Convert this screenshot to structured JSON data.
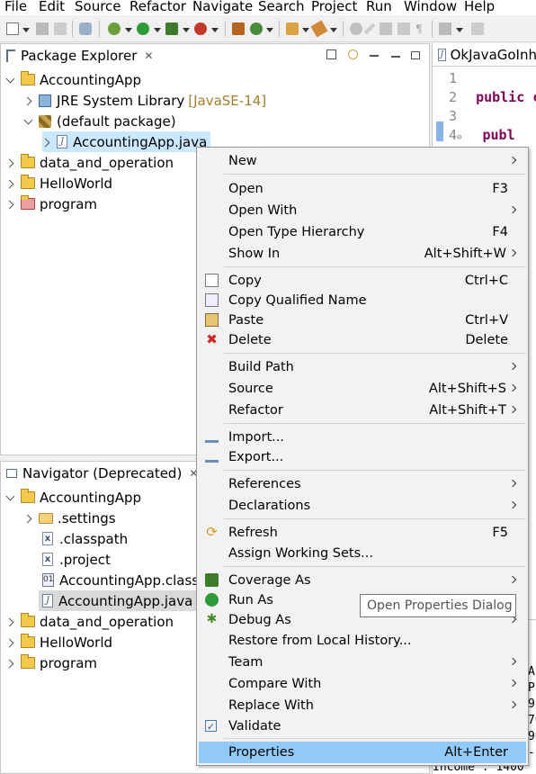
{
  "menubar": [
    "File",
    "Edit",
    "Source",
    "Refactor",
    "Navigate",
    "Search",
    "Project",
    "Run",
    "Window",
    "Help"
  ],
  "package_explorer": {
    "title": "Package Explorer",
    "close": "✕",
    "rows": [
      {
        "label": "AccountingApp"
      },
      {
        "label": "JRE System Library",
        "note": "[JavaSE-14]"
      },
      {
        "label": "(default package)"
      },
      {
        "label": "AccountingApp.java"
      },
      {
        "label": "data_and_operation"
      },
      {
        "label": "HelloWorld"
      },
      {
        "label": "program"
      }
    ]
  },
  "navigator": {
    "title": "Navigator (Deprecated)",
    "close": "✕",
    "rows": [
      {
        "label": "AccountingApp"
      },
      {
        "label": ".settings"
      },
      {
        "label": ".classpath"
      },
      {
        "label": ".project"
      },
      {
        "label": "AccountingApp.class"
      },
      {
        "label": "AccountingApp.java"
      },
      {
        "label": "data_and_operation"
      },
      {
        "label": "HelloWorld"
      },
      {
        "label": "program"
      }
    ]
  },
  "editor": {
    "tab": "OkJavaGoInh",
    "lines": [
      {
        "n": "1",
        "text": ""
      },
      {
        "n": "2",
        "kw": "public",
        "text": " c"
      },
      {
        "n": "3",
        "text": ""
      },
      {
        "n": "4",
        "kw": "publ",
        "text": ""
      }
    ],
    "console_fragments": [
      "Ac",
      "Pr",
      "9",
      "70",
      "90",
      "-1",
      "Income : 1400"
    ]
  },
  "context_menu": {
    "items": [
      {
        "label": "New",
        "shortcut": "",
        "submenu": true,
        "icon": ""
      },
      {
        "label": "Open",
        "shortcut": "F3",
        "submenu": false,
        "icon": ""
      },
      {
        "label": "Open With",
        "shortcut": "",
        "submenu": true,
        "icon": ""
      },
      {
        "label": "Open Type Hierarchy",
        "shortcut": "F4",
        "submenu": false,
        "icon": ""
      },
      {
        "label": "Show In",
        "shortcut": "Alt+Shift+W",
        "submenu": true,
        "icon": ""
      },
      {
        "label": "Copy",
        "shortcut": "Ctrl+C",
        "submenu": false,
        "icon": "copy-icon"
      },
      {
        "label": "Copy Qualified Name",
        "shortcut": "",
        "submenu": false,
        "icon": "copy-qualified-icon"
      },
      {
        "label": "Paste",
        "shortcut": "Ctrl+V",
        "submenu": false,
        "icon": "paste-icon"
      },
      {
        "label": "Delete",
        "shortcut": "Delete",
        "submenu": false,
        "icon": "delete-icon"
      },
      {
        "label": "Build Path",
        "shortcut": "",
        "submenu": true,
        "icon": ""
      },
      {
        "label": "Source",
        "shortcut": "Alt+Shift+S",
        "submenu": true,
        "icon": ""
      },
      {
        "label": "Refactor",
        "shortcut": "Alt+Shift+T",
        "submenu": true,
        "icon": ""
      },
      {
        "label": "Import...",
        "shortcut": "",
        "submenu": false,
        "icon": "import-icon"
      },
      {
        "label": "Export...",
        "shortcut": "",
        "submenu": false,
        "icon": "export-icon"
      },
      {
        "label": "References",
        "shortcut": "",
        "submenu": true,
        "icon": ""
      },
      {
        "label": "Declarations",
        "shortcut": "",
        "submenu": true,
        "icon": ""
      },
      {
        "label": "Refresh",
        "shortcut": "F5",
        "submenu": false,
        "icon": "refresh-icon"
      },
      {
        "label": "Assign Working Sets...",
        "shortcut": "",
        "submenu": false,
        "icon": ""
      },
      {
        "label": "Coverage As",
        "shortcut": "",
        "submenu": true,
        "icon": "coverage-icon"
      },
      {
        "label": "Run As",
        "shortcut": "",
        "submenu": true,
        "icon": "run-icon"
      },
      {
        "label": "Debug As",
        "shortcut": "",
        "submenu": true,
        "icon": "debug-icon"
      },
      {
        "label": "Restore from Local History...",
        "shortcut": "",
        "submenu": false,
        "icon": ""
      },
      {
        "label": "Team",
        "shortcut": "",
        "submenu": true,
        "icon": ""
      },
      {
        "label": "Compare With",
        "shortcut": "",
        "submenu": true,
        "icon": ""
      },
      {
        "label": "Replace With",
        "shortcut": "",
        "submenu": true,
        "icon": ""
      },
      {
        "label": "Validate",
        "shortcut": "",
        "submenu": false,
        "icon": "validate-icon"
      },
      {
        "label": "Properties",
        "shortcut": "Alt+Enter",
        "submenu": false,
        "icon": "",
        "highlighted": true
      }
    ]
  },
  "tooltip": "Open Properties Dialog",
  "colors": {
    "highlight": "#91c9f7",
    "selection": "#cce8ff",
    "keyword": "#7f0055",
    "library_note": "#a57f2c"
  }
}
